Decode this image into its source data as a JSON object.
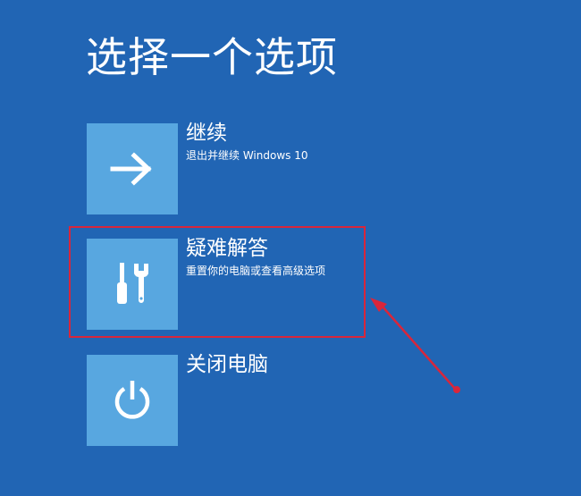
{
  "page_title": "选择一个选项",
  "options": [
    {
      "title": "继续",
      "description": "退出并继续 Windows 10",
      "icon": "arrow-right-icon"
    },
    {
      "title": "疑难解答",
      "description": "重置你的电脑或查看高级选项",
      "icon": "tools-icon"
    },
    {
      "title": "关闭电脑",
      "description": "",
      "icon": "power-icon"
    }
  ],
  "colors": {
    "background": "#2165b4",
    "tile": "#58a7e0",
    "annotation": "#d9263b"
  }
}
